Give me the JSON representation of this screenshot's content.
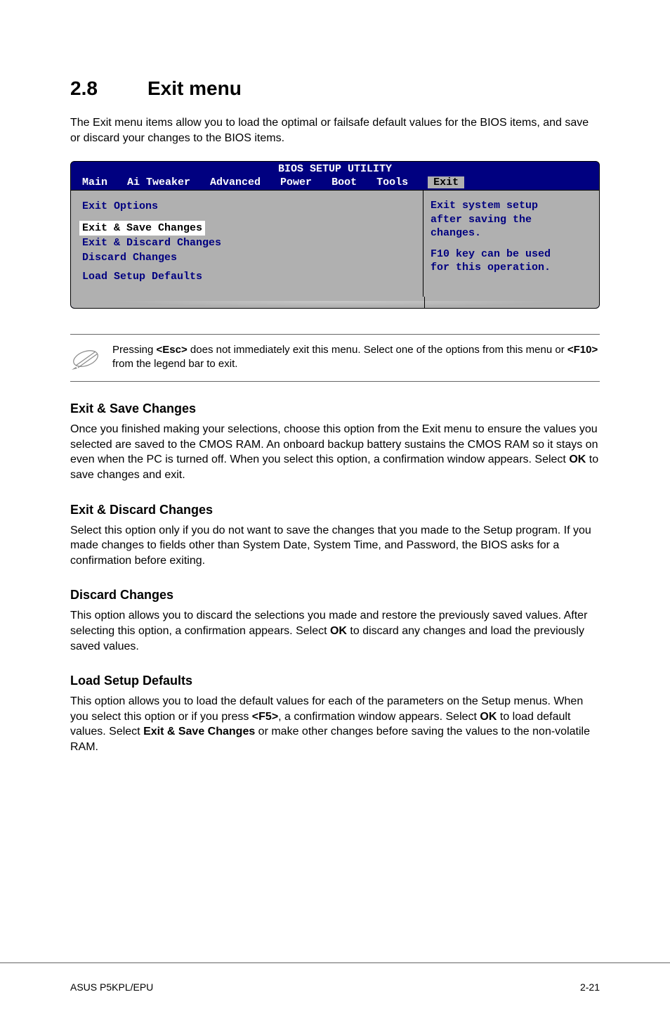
{
  "heading_number": "2.8",
  "heading_text": "Exit menu",
  "intro": "The Exit menu items allow you to load the optimal or failsafe default values for the BIOS items, and save or discard your changes to the BIOS items.",
  "bios": {
    "utility_title": "BIOS SETUP UTILITY",
    "menu": [
      "Main",
      "Ai Tweaker",
      "Advanced",
      "Power",
      "Boot",
      "Tools",
      "Exit"
    ],
    "left_label": "Exit Options",
    "items": [
      {
        "text": "Exit & Save Changes",
        "selected": true
      },
      {
        "text": "Exit & Discard Changes",
        "selected": false
      },
      {
        "text": "Discard Changes",
        "selected": false
      },
      {
        "text": "Load Setup Defaults",
        "selected": false
      }
    ],
    "help": {
      "l1": "Exit system setup",
      "l2": "after saving the",
      "l3": "changes.",
      "l4": "F10 key can be used",
      "l5": "for this operation."
    }
  },
  "note": {
    "p1a": "Pressing ",
    "p1b": "<Esc>",
    "p1c": " does not immediately exit this menu. Select one of the options from this menu or ",
    "p1d": "<F10>",
    "p1e": " from the legend bar to exit."
  },
  "sections": [
    {
      "title": "Exit & Save Changes",
      "body_parts": [
        "Once you finished making your selections, choose this option from the Exit menu to ensure the values you selected are saved to the CMOS RAM. An onboard backup battery sustains the CMOS RAM so it stays on even when the PC is turned off. When you select this option, a confirmation window appears. Select ",
        "OK",
        " to save changes and exit."
      ]
    },
    {
      "title": "Exit & Discard Changes",
      "body_parts": [
        "Select this option only if you do not want to save the changes that you made to the Setup program. If you made changes to fields other than System Date, System Time, and Password, the BIOS asks for a confirmation before exiting."
      ]
    },
    {
      "title": "Discard Changes",
      "body_parts": [
        "This option allows you to discard the selections you made and restore the previously saved values. After selecting this option, a confirmation appears. Select ",
        "OK",
        " to discard any changes and load the previously saved values."
      ]
    },
    {
      "title": "Load Setup Defaults",
      "body_parts": [
        "This option allows you to load the default values for each of the parameters on the Setup menus. When you select this option or if you press ",
        "<F5>",
        ", a confirmation window appears. Select ",
        "OK",
        " to load default values. Select ",
        "Exit & Save Changes",
        " or make other changes before saving the values to the non-volatile RAM."
      ]
    }
  ],
  "footer_left": "ASUS P5KPL/EPU",
  "footer_right": "2-21"
}
